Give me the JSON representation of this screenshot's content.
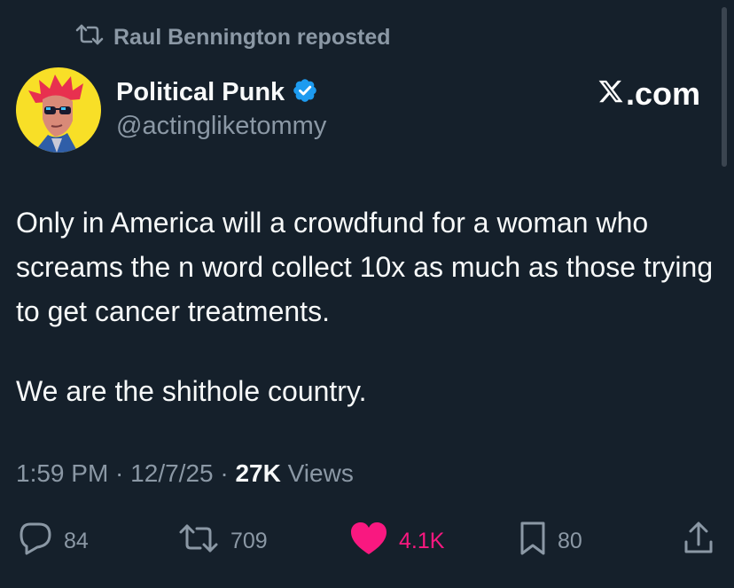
{
  "repost_banner": {
    "text": "Raul Bennington reposted",
    "icon": "repost-icon"
  },
  "author": {
    "display_name": "Political Punk",
    "handle": "@actingliketommy",
    "verified_icon": "verified-badge-icon",
    "avatar": "avatar-punk-illustration"
  },
  "brand": {
    "logo_icon": "x-logo-icon",
    "domain_suffix": ".com"
  },
  "tweet": {
    "paragraphs": [
      "Only in America will a crowdfund for a woman who screams the n word collect 10x as much as those trying to get cancer treatments.",
      "We are the shithole country."
    ]
  },
  "meta": {
    "time": "1:59 PM",
    "separator1": " · ",
    "date": "12/7/25",
    "separator2": " · ",
    "views_count": "27K",
    "views_label": " Views"
  },
  "actions": {
    "reply": {
      "icon": "reply-icon",
      "count": "84"
    },
    "repost": {
      "icon": "repost-icon",
      "count": "709"
    },
    "like": {
      "icon": "heart-icon",
      "count": "4.1K",
      "active": true
    },
    "bookmark": {
      "icon": "bookmark-icon",
      "count": "80"
    },
    "share": {
      "icon": "share-icon"
    }
  },
  "colors": {
    "background": "#15202b",
    "text_primary": "#f7f9f9",
    "text_secondary": "#8b98a5",
    "like_active": "#f91880",
    "verified": "#1d9bf0"
  }
}
